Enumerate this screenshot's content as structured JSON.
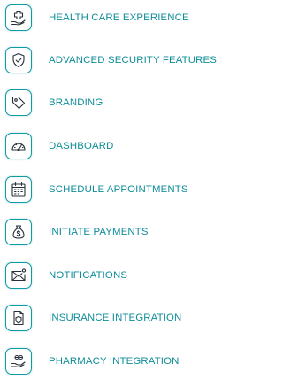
{
  "features": [
    {
      "label": "HEALTH CARE EXPERIENCE",
      "icon": "hand-medical-cross-icon"
    },
    {
      "label": "ADVANCED SECURITY FEATURES",
      "icon": "shield-check-icon"
    },
    {
      "label": "BRANDING",
      "icon": "tag-icon"
    },
    {
      "label": "DASHBOARD",
      "icon": "speedometer-icon"
    },
    {
      "label": "SCHEDULE APPOINTMENTS",
      "icon": "calendar-icon"
    },
    {
      "label": "INITIATE PAYMENTS",
      "icon": "money-bag-icon"
    },
    {
      "label": "NOTIFICATIONS",
      "icon": "envelope-notification-icon"
    },
    {
      "label": "INSURANCE INTEGRATION",
      "icon": "insurance-document-icon"
    },
    {
      "label": "PHARMACY INTEGRATION",
      "icon": "hand-pills-icon"
    }
  ],
  "colors": {
    "accent": "#0e9aa6",
    "label_text": "#0e8d99",
    "icon_stroke": "#26303a"
  }
}
